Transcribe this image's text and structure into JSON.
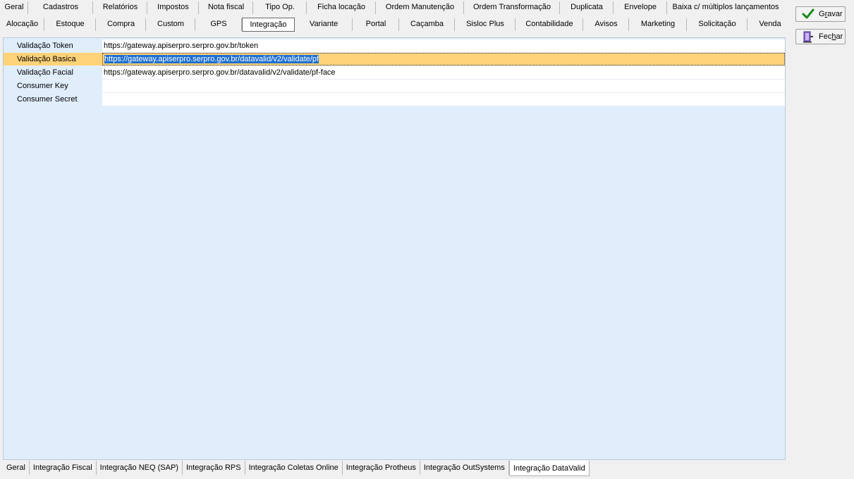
{
  "top_tabs": {
    "row1": [
      "Geral",
      "Cadastros",
      "Relatórios",
      "Impostos",
      "Nota fiscal",
      "Tipo Op.",
      "Ficha locação",
      "Ordem Manutenção",
      "Ordem Transformação",
      "Duplicata",
      "Envelope",
      "Baixa c/ múltiplos lançamentos"
    ],
    "row2": [
      "Alocação",
      "Estoque",
      "Compra",
      "Custom",
      "GPS",
      "Integração",
      "Variante",
      "Portal",
      "Caçamba",
      "Sisloc Plus",
      "Contabilidade",
      "Avisos",
      "Marketing",
      "Solicitação",
      "Venda"
    ],
    "active": "Integração"
  },
  "grid": {
    "rows": [
      {
        "label": "Validação Token",
        "value": "https://gateway.apiserpro.serpro.gov.br/token",
        "selected": false
      },
      {
        "label": "Validação Basica",
        "value": "https://gateway.apiserpro.serpro.gov.br/datavalid/v2/validate/pf",
        "selected": true
      },
      {
        "label": "Validação Facial",
        "value": "https://gateway.apiserpro.serpro.gov.br/datavalid/v2/validate/pf-face",
        "selected": false
      },
      {
        "label": "Consumer Key",
        "value": "",
        "selected": false
      },
      {
        "label": "Consumer Secret",
        "value": "",
        "selected": false
      }
    ]
  },
  "buttons": {
    "save": {
      "label_pre": "G",
      "label_ul": "r",
      "label_post": "avar",
      "icon": "checkmark-icon"
    },
    "close": {
      "label_pre": "Fec",
      "label_ul": "h",
      "label_post": "ar",
      "icon": "door-exit-icon"
    }
  },
  "bottom_tabs": {
    "items": [
      "Geral",
      "Integração Fiscal",
      "Integração NEQ (SAP)",
      "Integração RPS",
      "Integração Coletas Online",
      "Integração Protheus",
      "Integração OutSystems",
      "Integração DataValid"
    ],
    "active": "Integração DataValid"
  },
  "colors": {
    "selection": "#fdd279",
    "highlight": "#1f6fd0",
    "panel": "#e0edfb"
  }
}
